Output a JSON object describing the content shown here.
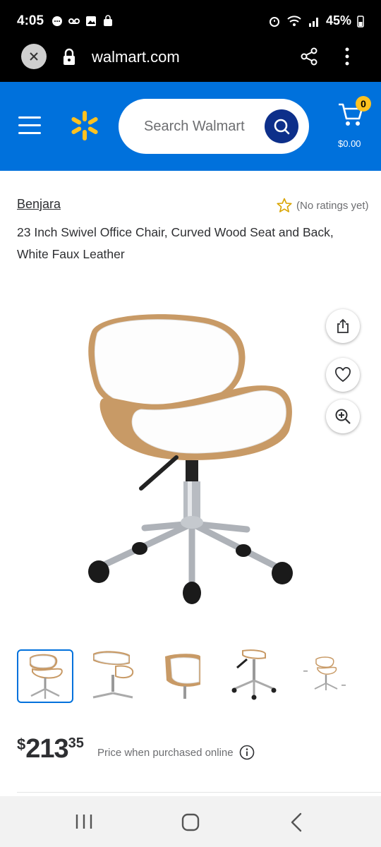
{
  "status_bar": {
    "time": "4:05",
    "battery": "45%"
  },
  "browser": {
    "url": "walmart.com"
  },
  "header": {
    "search_placeholder": "Search Walmart",
    "cart_count": "0",
    "cart_total": "$0.00",
    "accent_color": "#0071dc",
    "spark_color": "#ffc220"
  },
  "product": {
    "brand": "Benjara",
    "rating_text": "(No ratings yet)",
    "title": "23 Inch Swivel Office Chair, Curved Wood Seat and Back, White Faux Leather",
    "price_symbol": "$",
    "price_dollars": "213",
    "price_cents": "35",
    "price_note": "Price when purchased online"
  },
  "icons": {
    "image_actions": [
      "share-icon",
      "heart-icon",
      "zoom-in-icon"
    ],
    "nav": [
      "recents-icon",
      "home-icon",
      "back-icon"
    ]
  },
  "thumbnails": {
    "count": 5,
    "selected_index": 0
  }
}
